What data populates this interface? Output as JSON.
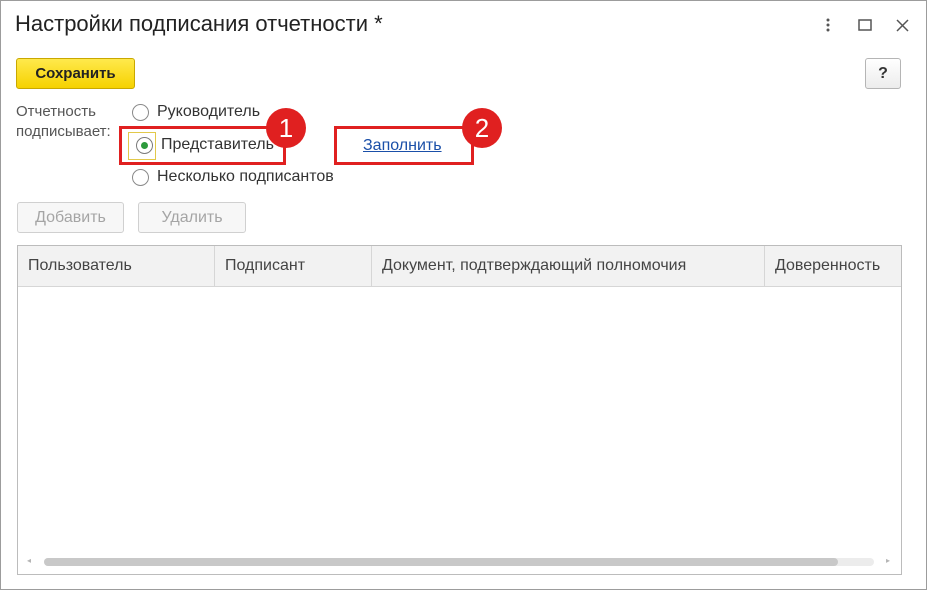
{
  "window": {
    "title": "Настройки подписания отчетности *",
    "controls": [
      {
        "name": "more-icon",
        "glyph": "⋮"
      },
      {
        "name": "maximize-icon",
        "glyph": "☐"
      },
      {
        "name": "close-icon",
        "glyph": "✕"
      }
    ]
  },
  "toolbar": {
    "save_label": "Сохранить",
    "help_label": "?"
  },
  "signing": {
    "label_line1": "Отчетность",
    "label_line2": "подписывает:",
    "options": [
      {
        "label": "Руководитель",
        "selected": false
      },
      {
        "label": "Представитель",
        "selected": true
      },
      {
        "label": "Несколько подписантов",
        "selected": false
      }
    ],
    "fill_link": "Заполнить"
  },
  "callouts": {
    "one": "1",
    "two": "2",
    "color": "#e02020"
  },
  "table_actions": {
    "add_label": "Добавить",
    "delete_label": "Удалить"
  },
  "table": {
    "columns": [
      "Пользователь",
      "Подписант",
      "Документ, подтверждающий полномочия",
      "Доверенность"
    ],
    "rows": []
  },
  "colors": {
    "accent_yellow": "#f6d200",
    "radio_dot": "#2d9a3c",
    "link": "#1a4fa8"
  }
}
